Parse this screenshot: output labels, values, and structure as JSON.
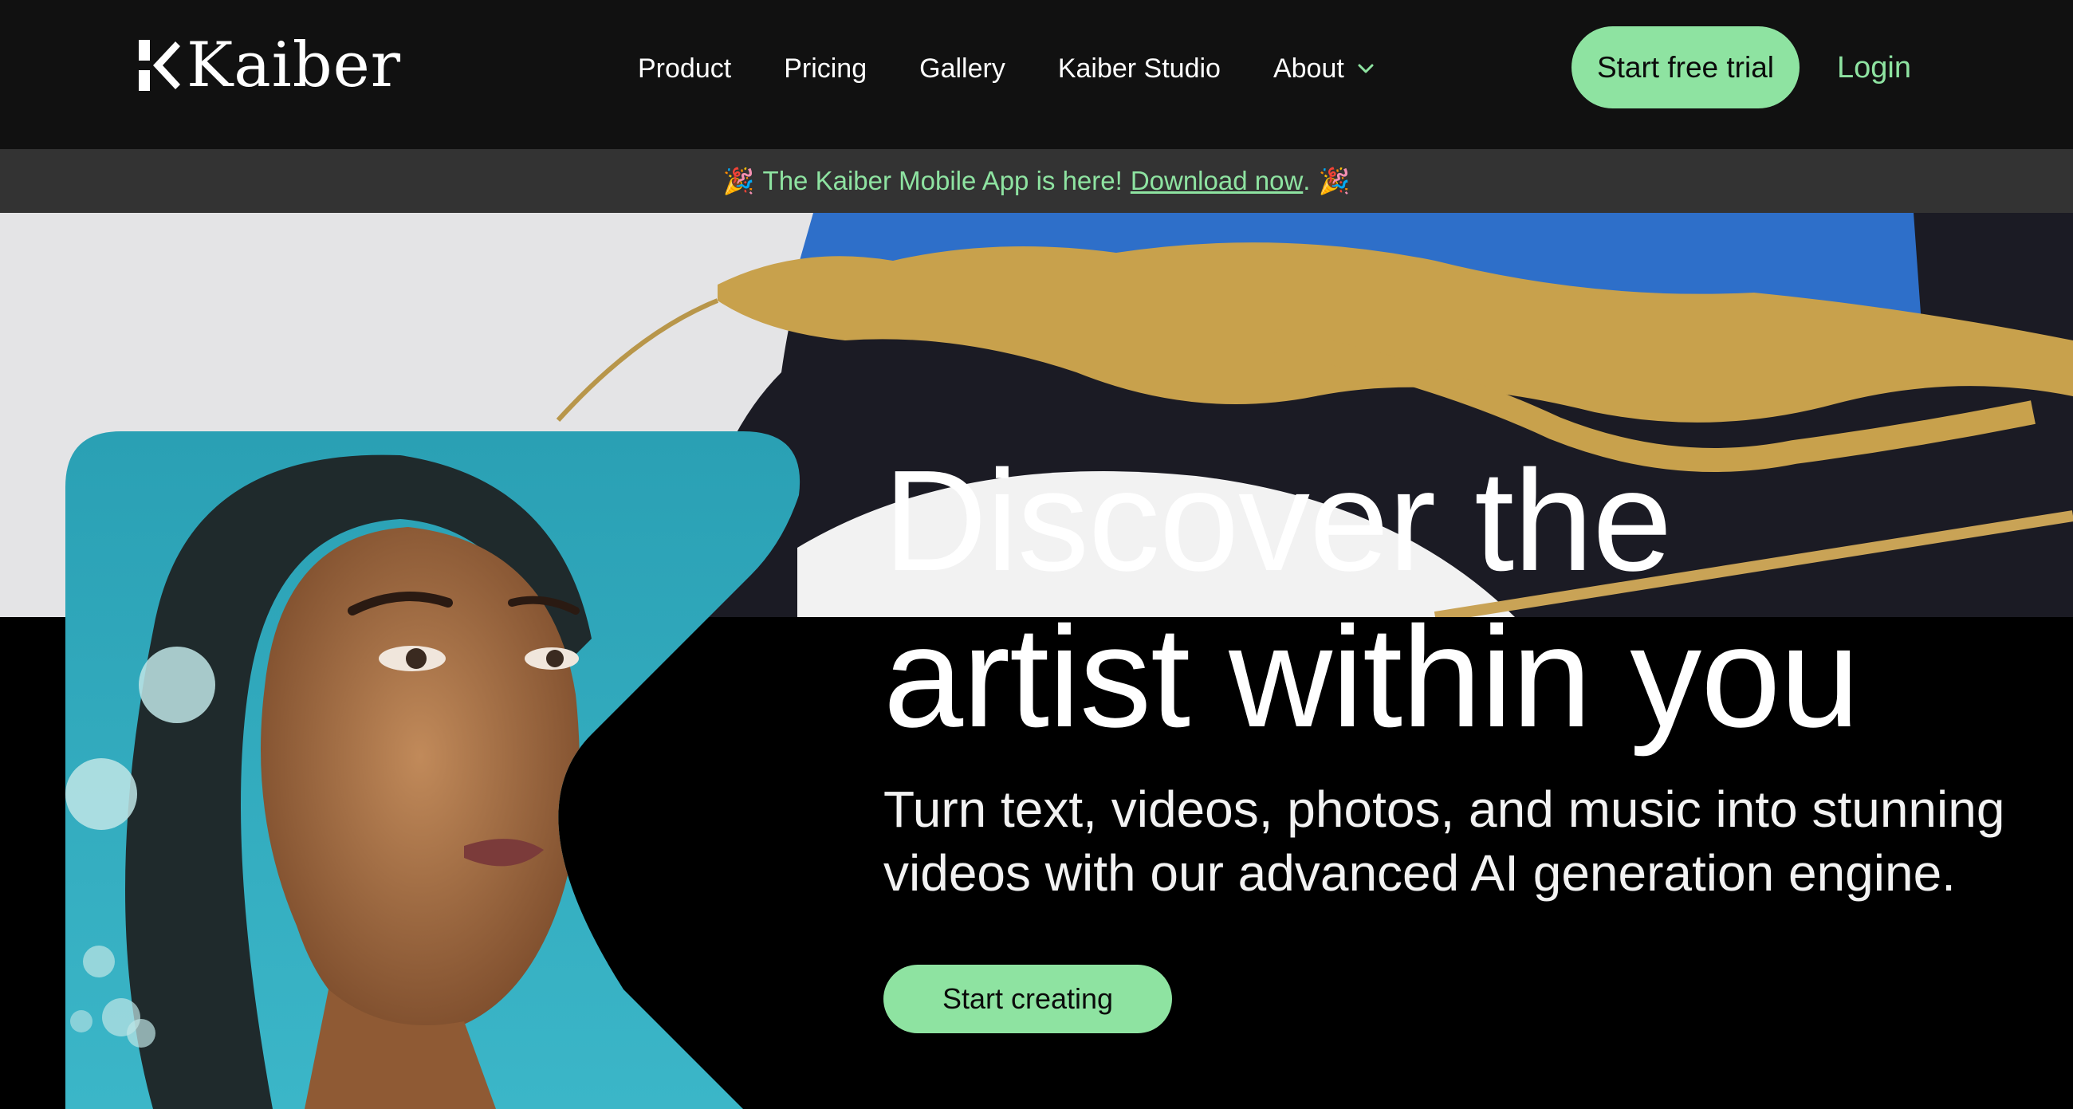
{
  "brand": {
    "name": "Kaiber",
    "logo_icon": "kaiber-k-icon",
    "accent_color": "#8ee3a1"
  },
  "nav": {
    "items": [
      {
        "label": "Product"
      },
      {
        "label": "Pricing"
      },
      {
        "label": "Gallery"
      },
      {
        "label": "Kaiber Studio"
      },
      {
        "label": "About",
        "icon": "chevron-down-icon"
      }
    ],
    "cta_label": "Start free trial",
    "login_label": "Login"
  },
  "announcement": {
    "icon": "party-popper-icon",
    "glyph": "🎉",
    "text": "The Kaiber Mobile App is here!",
    "link_label": "Download now",
    "suffix": "."
  },
  "hero": {
    "headline_line1": "Discover the",
    "headline_line2": "artist within you",
    "subtitle_line1": "Turn text, videos, photos, and music into stunning",
    "subtitle_line2": "videos with our advanced AI generation engine.",
    "cta_label": "Start creating"
  }
}
